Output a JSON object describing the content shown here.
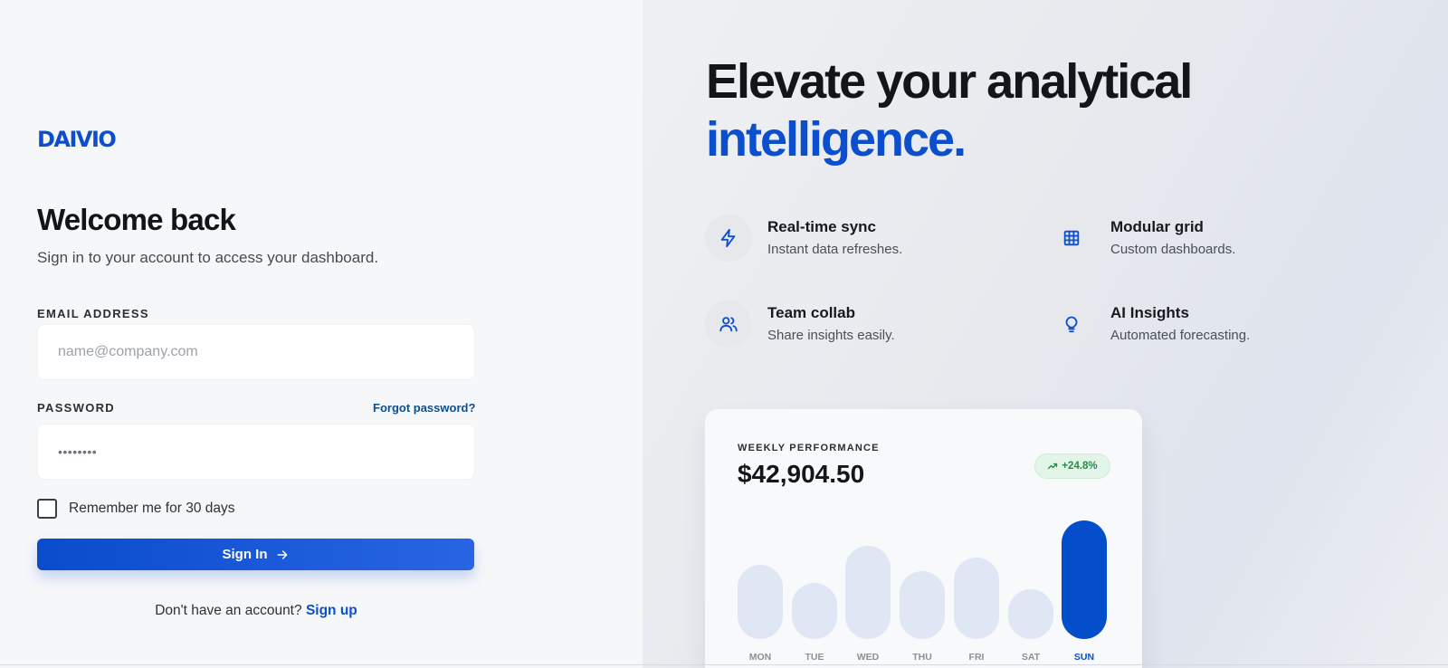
{
  "brand": {
    "logo": "DAIVIO"
  },
  "login": {
    "title": "Welcome back",
    "subtitle": "Sign in to your account to access your dashboard.",
    "email_label": "EMAIL ADDRESS",
    "email_placeholder": "name@company.com",
    "password_label": "PASSWORD",
    "forgot_link": "Forgot password?",
    "password_placeholder": "••••••••",
    "remember_label": "Remember me for 30 days",
    "remember_checked": false,
    "signin_label": "Sign In",
    "signup_prompt": "Don't have an account?",
    "signup_link": "Sign up"
  },
  "hero": {
    "line1": "Elevate your analytical",
    "line2": "intelligence."
  },
  "features": [
    {
      "icon": "lightning-icon",
      "title": "Real-time sync",
      "desc": "Instant data refreshes."
    },
    {
      "icon": "grid-icon",
      "title": "Modular grid",
      "desc": "Custom dashboards."
    },
    {
      "icon": "users-icon",
      "title": "Team collab",
      "desc": "Share insights easily."
    },
    {
      "icon": "lightbulb-icon",
      "title": "AI Insights",
      "desc": "Automated forecasting."
    }
  ],
  "performance": {
    "label": "WEEKLY PERFORMANCE",
    "value": "$42,904.50",
    "change": "+24.8%"
  },
  "colors": {
    "accent": "#0b4fcf",
    "positive": "#1f8f43",
    "bar_inactive": "#dfe6f4",
    "bar_active": "#044dcb"
  },
  "chart_data": {
    "type": "bar",
    "categories": [
      "MON",
      "TUE",
      "WED",
      "THU",
      "FRI",
      "SAT",
      "SUN"
    ],
    "values": [
      82,
      62,
      103,
      75,
      90,
      55,
      131
    ],
    "highlight": "SUN",
    "ylim": [
      0,
      131
    ]
  }
}
